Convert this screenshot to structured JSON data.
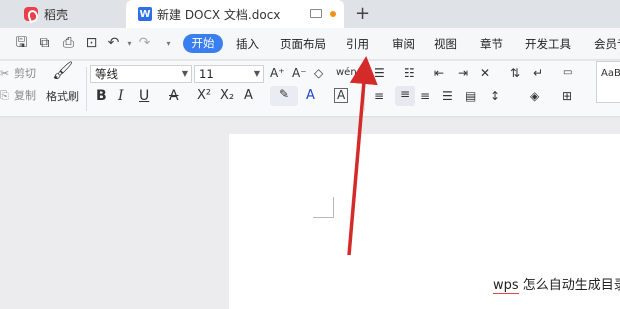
{
  "tabs": [
    {
      "label": "稻壳"
    },
    {
      "label": "新建 DOCX 文档.docx"
    }
  ],
  "new_tab_label": "+",
  "menu": {
    "active": "开始",
    "items": [
      "插入",
      "页面布局",
      "引用",
      "审阅",
      "视图",
      "章节",
      "开发工具",
      "会员专"
    ]
  },
  "ribbon": {
    "cut": "剪切",
    "copy": "复制",
    "format_painter": "格式刷",
    "font_name": "等线",
    "font_size": "11",
    "style_preview": "AaB"
  },
  "document": {
    "text_prefix": "wps",
    "text_rest": " 怎么自动生成目录"
  },
  "colors": {
    "accent": "#3a7ff0",
    "arrow": "#d42a2a",
    "highlight": "#f5e54a",
    "font_color": "#e53935"
  },
  "icons": [
    "save-icon",
    "template-icon",
    "print-icon",
    "preview-icon",
    "undo-icon",
    "redo-icon",
    "scissors-icon",
    "copy-icon",
    "brush-icon",
    "bold-icon",
    "italic-icon",
    "underline-icon",
    "strikethrough-icon",
    "superscript-icon",
    "subscript-icon",
    "text-effect-icon",
    "highlight-icon",
    "font-color-icon",
    "char-border-icon",
    "align-left-icon",
    "align-center-icon",
    "align-right-icon",
    "justify-icon",
    "distribute-icon",
    "line-spacing-icon",
    "shading-icon",
    "border-icon",
    "bullets-icon",
    "numbering-icon",
    "indent-icon",
    "outdent-icon",
    "sort-icon",
    "show-marks-icon",
    "grow-font-icon",
    "shrink-font-icon",
    "clear-format-icon",
    "phonetic-icon"
  ]
}
